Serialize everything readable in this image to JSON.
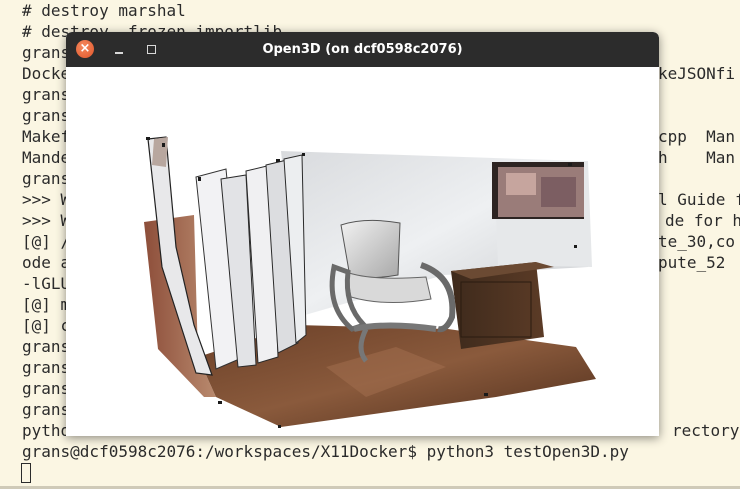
{
  "terminal": {
    "lines": [
      {
        "left": "# destroy marshal",
        "right": ""
      },
      {
        "left": "# destroy _frozen_importlib",
        "right": ""
      },
      {
        "left": "grans",
        "right": ""
      },
      {
        "left": "Docke",
        "right": "keJSONfi"
      },
      {
        "left": "grans",
        "right": ""
      },
      {
        "left": "grans",
        "right": ""
      },
      {
        "left": "Makef",
        "right": "cpp  Man"
      },
      {
        "left": "Mande",
        "right": "h    Man"
      },
      {
        "left": "grans",
        "right": ""
      },
      {
        "left": ">>> W",
        "right": "l Guide f"
      },
      {
        "left": ">>> W",
        "right": "de for h"
      },
      {
        "left": "[@] /",
        "right": "te_30,co"
      },
      {
        "left": "ode a",
        "right": "pute_52"
      },
      {
        "left": "-lGLU",
        "right": ""
      },
      {
        "left": "[@] m",
        "right": ""
      },
      {
        "left": "[@] c",
        "right": ""
      },
      {
        "left": "grans",
        "right": ""
      },
      {
        "left": "grans",
        "right": ""
      },
      {
        "left": "grans",
        "right": ""
      },
      {
        "left": "grans",
        "right": ""
      },
      {
        "left": "pytho",
        "right": "rectory"
      },
      {
        "left": "grans@dcf0598c2076:/workspaces/X11Docker$ python3 testOpen3D.py",
        "right": ""
      }
    ]
  },
  "window": {
    "title": "Open3D (on dcf0598c2076)",
    "close_glyph": "×",
    "viewport_content": "3D point cloud rendering of a room with a chair, cabinet and shelves"
  },
  "colors": {
    "terminal_bg": "#fbf6e3",
    "terminal_text": "#2b2b2b",
    "titlebar": "#2c2c2c",
    "close_button": "#e95420"
  }
}
